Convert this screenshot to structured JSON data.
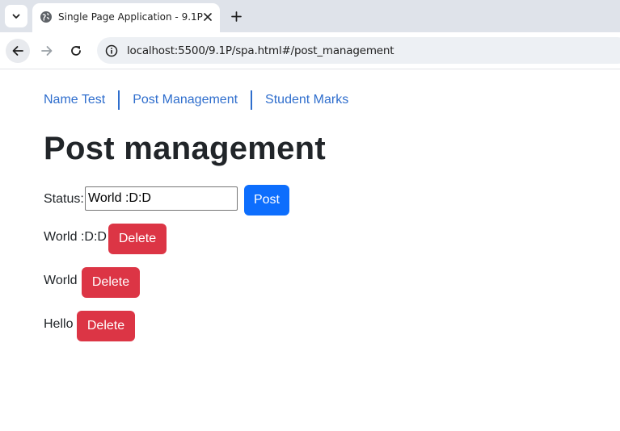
{
  "browser": {
    "tab_title": "Single Page Application - 9.1P",
    "url": "localhost:5500/9.1P/spa.html#/post_management"
  },
  "nav": {
    "links": [
      "Name Test",
      "Post Management",
      "Student Marks"
    ]
  },
  "page": {
    "title": "Post management",
    "status_label": "Status:",
    "status_value": "World :D:D",
    "post_button": "Post",
    "delete_label": "Delete",
    "posts": [
      "World :D:D",
      "World",
      "Hello"
    ]
  },
  "colors": {
    "link": "#2f6ecd",
    "primary_button": "#0d6efd",
    "danger_button": "#dc3545"
  }
}
